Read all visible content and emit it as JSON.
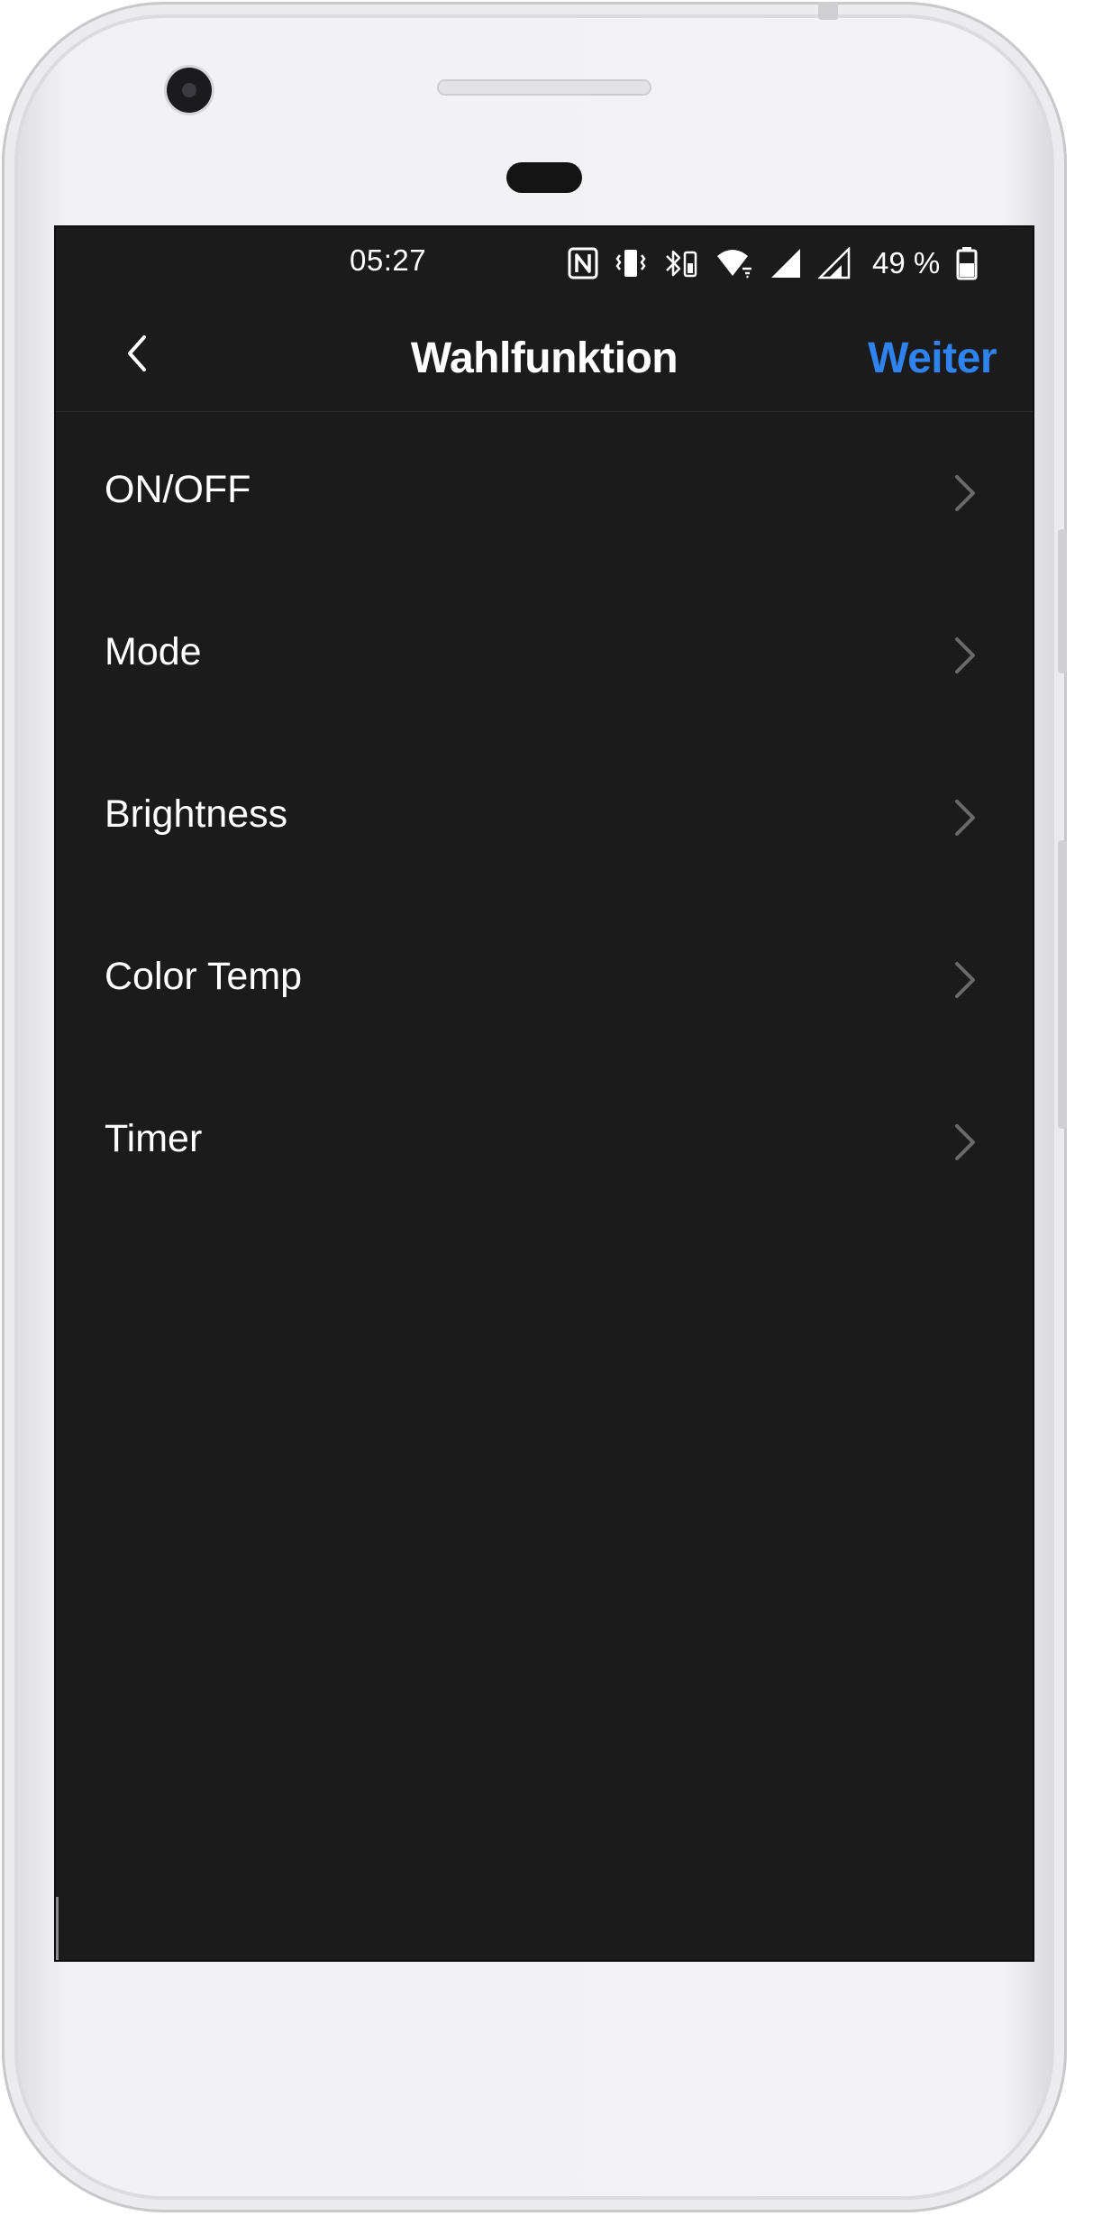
{
  "statusbar": {
    "time": "05:27",
    "battery": "49 %",
    "icons": [
      "nfc-icon",
      "vibrate-icon",
      "bluetooth-icon",
      "wifi-icon",
      "signal-icon",
      "signal-icon",
      "battery-icon"
    ]
  },
  "navbar": {
    "back_icon": "chevron-left-icon",
    "title": "Wahlfunktion",
    "next_label": "Weiter",
    "accent_color": "#2f83f0"
  },
  "list": {
    "items": [
      {
        "label": "ON/OFF",
        "icon": "chevron-right-icon"
      },
      {
        "label": "Mode",
        "icon": "chevron-right-icon"
      },
      {
        "label": "Brightness",
        "icon": "chevron-right-icon"
      },
      {
        "label": "Color Temp",
        "icon": "chevron-right-icon"
      },
      {
        "label": "Timer",
        "icon": "chevron-right-icon"
      }
    ]
  },
  "colors": {
    "screen_background": "#1b1b1b",
    "text": "#ffffff",
    "chevron": "#6a6a6a"
  }
}
